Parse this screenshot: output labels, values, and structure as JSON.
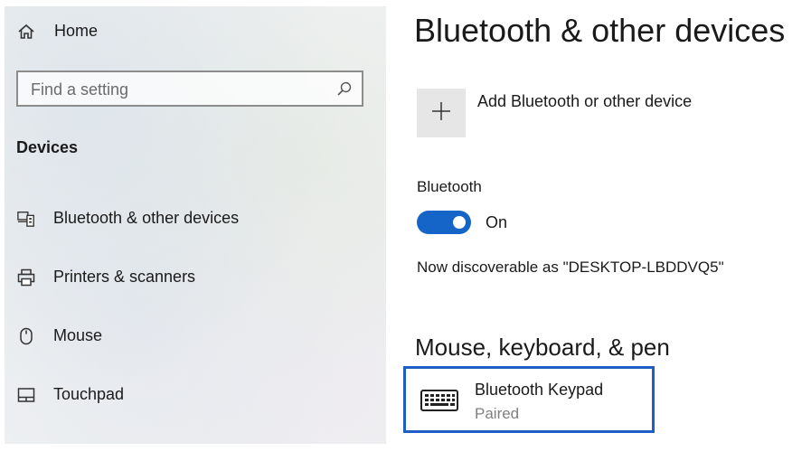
{
  "sidebar": {
    "home_label": "Home",
    "search_placeholder": "Find a setting",
    "section_title": "Devices",
    "items": [
      {
        "label": "Bluetooth & other devices",
        "icon": "bluetooth-devices-icon"
      },
      {
        "label": "Printers & scanners",
        "icon": "printer-icon"
      },
      {
        "label": "Mouse",
        "icon": "mouse-icon"
      },
      {
        "label": "Touchpad",
        "icon": "touchpad-icon"
      }
    ]
  },
  "main": {
    "title": "Bluetooth & other devices",
    "add_device_label": "Add Bluetooth or other device",
    "bluetooth_label": "Bluetooth",
    "bluetooth_state": "On",
    "discoverable_text": "Now discoverable as \"DESKTOP-LBDDVQ5\"",
    "section_mouse": "Mouse, keyboard, & pen",
    "device": {
      "name": "Bluetooth Keypad",
      "status": "Paired",
      "icon": "keyboard-icon"
    }
  },
  "colors": {
    "accent": "#1565c9",
    "selection_border": "#1f5fc4",
    "muted_text": "#808080"
  }
}
